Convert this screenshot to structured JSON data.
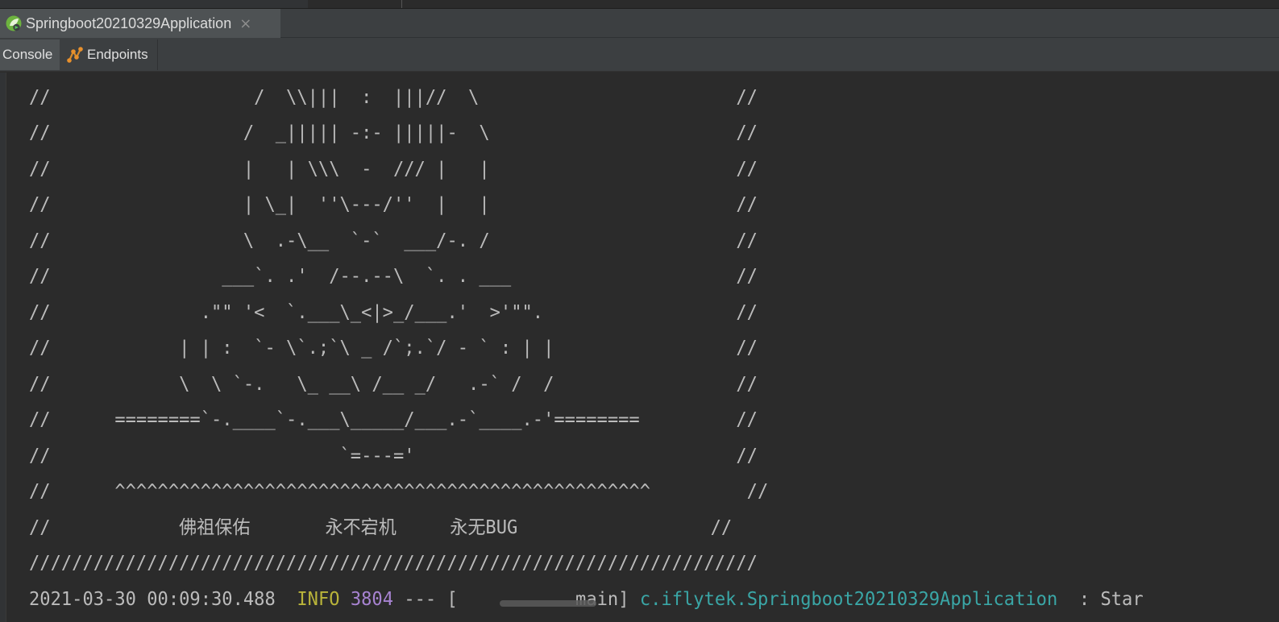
{
  "run_tab": {
    "title": "Springboot20210329Application",
    "close": "×",
    "icon": "spring-run-icon"
  },
  "toolbar": {
    "console_label": "Console",
    "endpoints_label": "Endpoints",
    "endpoints_icon": "endpoints-icon"
  },
  "console_lines": [
    "//                   /  \\\\|||  :  |||//  \\                        //",
    "//                  /  _||||| -:- |||||-  \\                       //",
    "//                  |   | \\\\\\  -  /// |   |                       //",
    "//                  | \\_|  ''\\---/''  |   |                       //",
    "//                  \\  .-\\__  `-`  ___/-. /                       //",
    "//                ___`. .'  /--.--\\  `. . ___                     //",
    "//              .\"\" '<  `.___\\_<|>_/___.'  >'\"\".                  //",
    "//            | | :  `- \\`.;`\\ _ /`;.`/ - ` : | |                 //",
    "//            \\  \\ `-.   \\_ __\\ /__ _/   .-` /  /                 //",
    "//      ========`-.____`-.___\\_____/___.-`____.-'========         //",
    "//                           `=---='                              //",
    "//      ^^^^^^^^^^^^^^^^^^^^^^^^^^^^^^^^^^^^^^^^^^^^^^^^^^         //",
    "//            佛祖保佑       永不宕机     永无BUG                  //",
    "////////////////////////////////////////////////////////////////////"
  ],
  "log_line": {
    "timestamp": "2021-03-30 00:09:30.488",
    "level": "INFO",
    "pid": "3804",
    "sep": "--- [",
    "thread": "main]",
    "logger": "c.iflytek.Springboot20210329Application",
    "message": ": Star"
  },
  "colors": {
    "console_bg": "#2b2b2b",
    "text": "#bbbbbb",
    "info": "#b9b43a",
    "pid": "#a783d1",
    "logger": "#3aa6a6"
  }
}
